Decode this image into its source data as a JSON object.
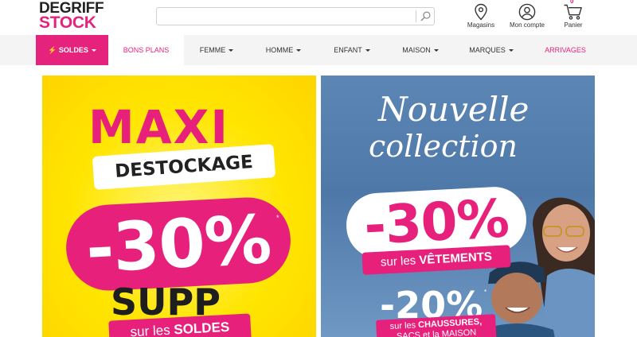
{
  "logo": {
    "line1": "DEGRIFF",
    "line2": "STOCK"
  },
  "search": {
    "value": "",
    "placeholder": ""
  },
  "header_icons": {
    "stores": {
      "label": "Magasins",
      "icon": "map-pin-icon"
    },
    "account": {
      "label": "Mon compte",
      "icon": "user-icon"
    },
    "cart": {
      "label": "Panier",
      "icon": "cart-icon",
      "count": "0"
    }
  },
  "nav": {
    "soldes": "SOLDES",
    "bons_plans": "BONS PLANS",
    "femme": "FEMME",
    "homme": "HOMME",
    "enfant": "ENFANT",
    "maison": "MAISON",
    "marques": "MARQUES",
    "arrivages": "ARRIVAGES"
  },
  "banner_left": {
    "maxi": "MAXI",
    "destockage": "DESTOCKAGE",
    "percent": "-30%",
    "star": "*",
    "supp": "SUPP",
    "soldes_prefix": "sur les ",
    "soldes_strong": "SOLDES"
  },
  "banner_right": {
    "nouvelle": "Nouvelle",
    "collection": "collection",
    "percent": "-30%",
    "star": "*",
    "vetements_prefix": "sur les ",
    "vetements_strong": "VÊTEMENTS",
    "percent2": "-20%",
    "star2": "*",
    "chaussures_prefix": "sur les ",
    "chaussures_strong": "CHAUSSURES,",
    "chaussures_line2": "SACS et la MAISON"
  },
  "colors": {
    "brand_pink": "#e5237d",
    "banner_yellow": "#ffe500",
    "banner_blue": "#5c86b4"
  }
}
